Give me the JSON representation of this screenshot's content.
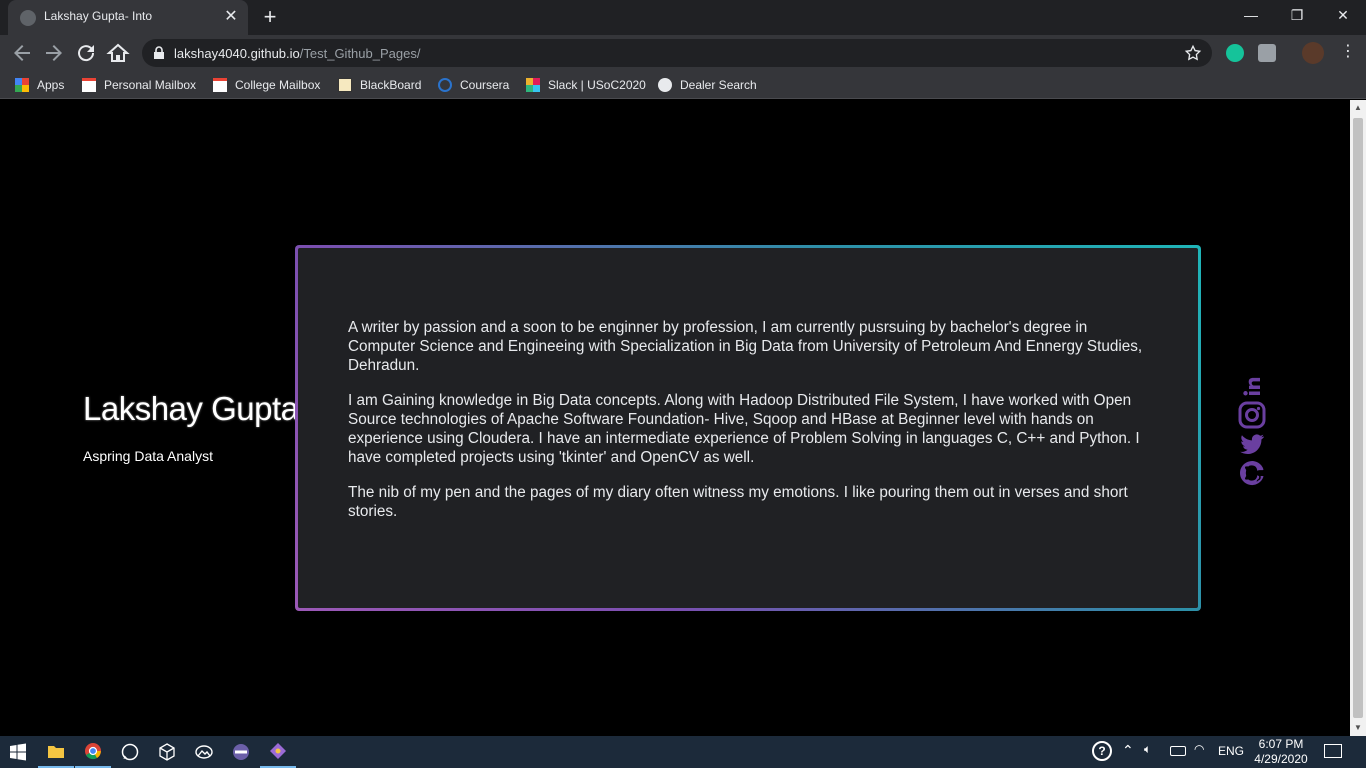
{
  "browser": {
    "tab_title": "Lakshay Gupta- Into",
    "url_host": "lakshay4040.github.io",
    "url_path": "/Test_Github_Pages/",
    "bookmarks": [
      "Apps",
      "Personal Mailbox",
      "College Mailbox",
      "BlackBoard",
      "Coursera",
      "Slack | USoC2020",
      "Dealer Search"
    ]
  },
  "page": {
    "name": "Lakshay Gupta",
    "subtitle": "Aspring Data Analyst",
    "paragraphs": [
      "A writer by passion and a soon to be enginner by profession, I am currently pusrsuing by bachelor's degree in Computer Science and Engineeing with Specialization in Big Data from University of Petroleum And Ennergy Studies, Dehradun.",
      "I am Gaining knowledge in Big Data concepts. Along with Hadoop Distributed File System, I have worked with Open Source technologies of Apache Software Foundation- Hive, Sqoop and HBase at Beginner level with hands on experience using Cloudera. I have an intermediate experience of Problem Solving in languages C, C++ and Python. I have completed projects using 'tkinter' and OpenCV as well.",
      "The nib of my pen and the pages of my diary often witness my emotions. I like pouring them out in verses and short stories."
    ],
    "social_icons": [
      "linkedin-icon",
      "instagram-icon",
      "twitter-icon",
      "github-icon"
    ],
    "accent_color": "#6a3fa0"
  },
  "taskbar": {
    "lang": "ENG",
    "time": "6:07 PM",
    "date": "4/29/2020"
  }
}
